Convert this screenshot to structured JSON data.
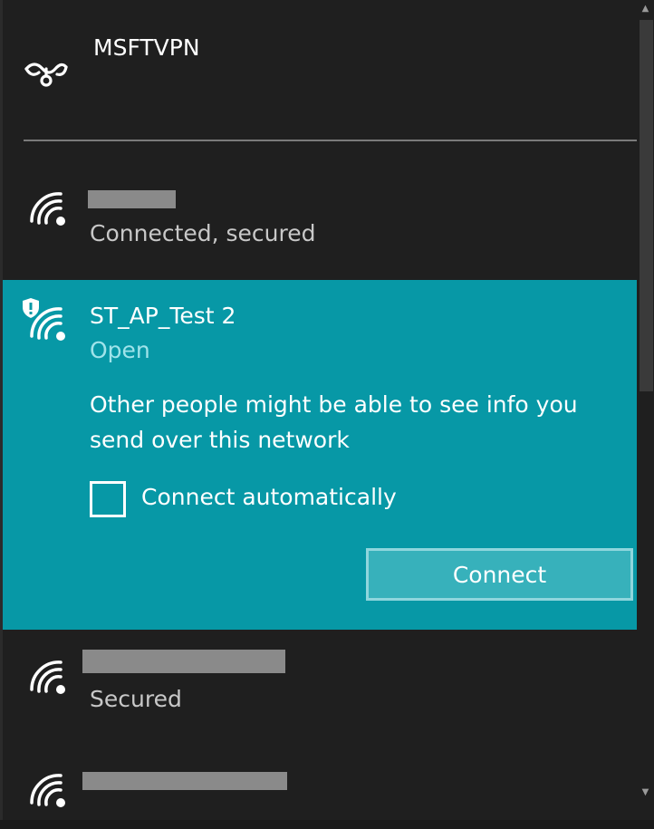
{
  "vpn": {
    "name": "MSFTVPN",
    "icon": "vpn-link-icon"
  },
  "networks": [
    {
      "name": "",
      "status": "Connected, secured",
      "icon": "wifi-icon",
      "name_redacted": true
    },
    {
      "name": "ST_AP_Test 2",
      "status": "Open",
      "icon": "wifi-shield-icon",
      "selected": true,
      "warning": "Other people might be able to see info you send over this network",
      "connect_auto_label": "Connect automatically",
      "connect_auto_checked": false,
      "connect_button_label": "Connect"
    },
    {
      "name": "",
      "status": "Secured",
      "icon": "wifi-icon",
      "name_redacted": true
    },
    {
      "name": "",
      "status": "",
      "icon": "wifi-icon",
      "name_redacted": true
    }
  ],
  "colors": {
    "background": "#1f1f1f",
    "accent": "#0798a6",
    "accent_button": "#37b1bb"
  },
  "scrollbar": {
    "up_icon": "scroll-up-arrow-icon",
    "down_icon": "scroll-down-arrow-icon"
  }
}
